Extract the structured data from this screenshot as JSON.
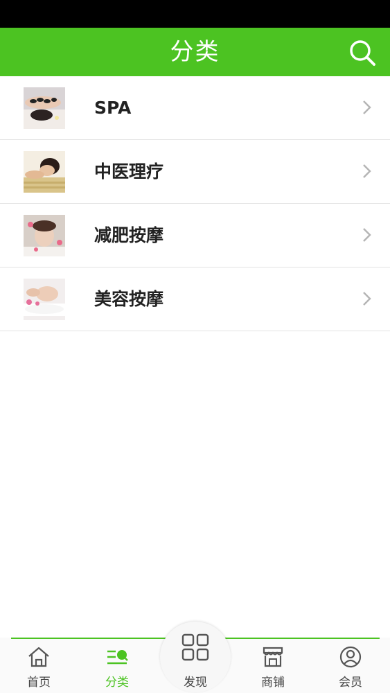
{
  "header": {
    "title": "分类",
    "search_icon": "search-icon"
  },
  "categories": [
    {
      "label": "SPA",
      "thumb": "hot-stone-spa-photo"
    },
    {
      "label": "中医理疗",
      "thumb": "tcm-therapy-photo"
    },
    {
      "label": "减肥按摩",
      "thumb": "slimming-massage-photo"
    },
    {
      "label": "美容按摩",
      "thumb": "beauty-massage-photo"
    }
  ],
  "tabbar": {
    "home": "首页",
    "category": "分类",
    "discover": "发现",
    "shop": "商铺",
    "member": "会员",
    "active": "category"
  },
  "colors": {
    "accent": "#4cc322",
    "status_bar": "#000000"
  }
}
